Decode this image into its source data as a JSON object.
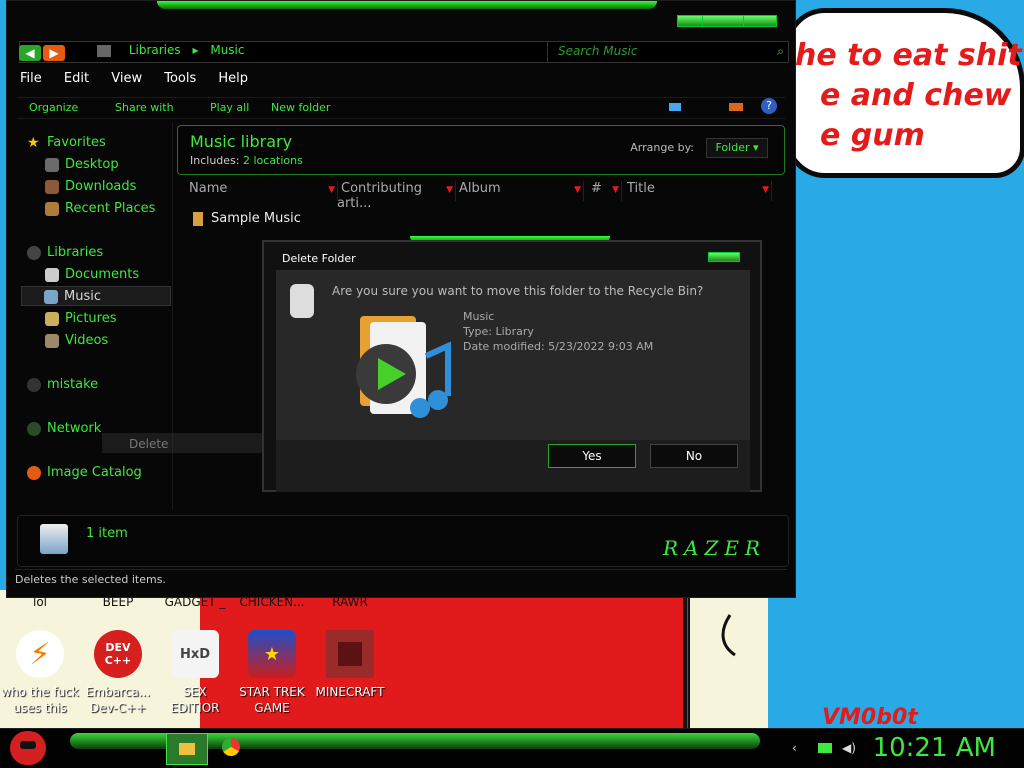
{
  "wallpaper": {
    "speech_lines": [
      "he to eat shit",
      "e and chew",
      "e gum"
    ],
    "tag": "VM0b0t"
  },
  "desktop": {
    "top_labels": [
      "lol",
      "BEEP",
      "GADGET _",
      "CHICKEN...",
      "RAWR"
    ],
    "icons": [
      {
        "line1": "who the fuck",
        "line2": "uses this",
        "icon": "lightning-icon"
      },
      {
        "line1": "Embarca...",
        "line2": "Dev-C++",
        "icon": "devcpp-icon",
        "badge": "DEV C++"
      },
      {
        "line1": "SEX",
        "line2": "EDITIOR",
        "icon": "hxd-icon",
        "badge": "HxD"
      },
      {
        "line1": "STAR TREK",
        "line2": "GAME",
        "icon": "star-trek-icon"
      },
      {
        "line1": "MINECRAFT",
        "line2": "",
        "icon": "minecraft-icon"
      }
    ]
  },
  "explorer": {
    "address": {
      "crumb1": "Libraries",
      "crumb2": "Music",
      "sep": "▸"
    },
    "search_placeholder": "Search Music",
    "menu": [
      "File",
      "Edit",
      "View",
      "Tools",
      "Help"
    ],
    "toolbar": [
      "Organize",
      "Share with",
      "Play all",
      "New folder"
    ],
    "nav": {
      "favorites": "Favorites",
      "desktop": "Desktop",
      "downloads": "Downloads",
      "recent": "Recent Places",
      "libraries": "Libraries",
      "documents": "Documents",
      "music": "Music",
      "pictures": "Pictures",
      "videos": "Videos",
      "mistake": "mistake",
      "network": "Network",
      "image_catalog": "Image Catalog"
    },
    "library": {
      "title": "Music library",
      "includes_label": "Includes:",
      "includes_value": "2 locations",
      "arrange_label": "Arrange by:",
      "arrange_value": "Folder"
    },
    "columns": [
      "Name",
      "Contributing arti...",
      "Album",
      "#",
      "Title"
    ],
    "rows": [
      "Sample Music"
    ],
    "status": {
      "count": "1 item",
      "brand": "RAZER"
    },
    "hint": "Deletes the selected items.",
    "drag_ghost": "Delete"
  },
  "dialog": {
    "title": "Delete Folder",
    "question": "Are you sure you want to move this folder to the Recycle Bin?",
    "name": "Music",
    "type": "Type: Library",
    "date": "Date modified: 5/23/2022 9:03 AM",
    "yes": "Yes",
    "no": "No"
  },
  "taskbar": {
    "clock": "10:21 AM"
  },
  "colors": {
    "accent": "#3ee83e",
    "window_bg": "#070707",
    "desktop_bg": "#29a9e6",
    "wall_red": "#e11b1b"
  }
}
